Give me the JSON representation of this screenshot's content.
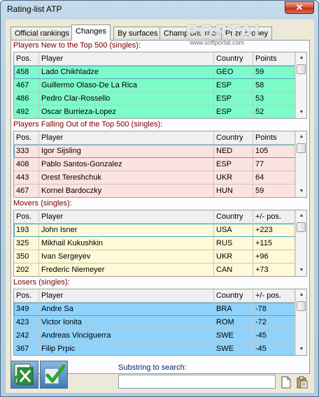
{
  "window": {
    "title": "Rating-list ATP",
    "close_glyph": "✕"
  },
  "tabs": [
    {
      "label": "Official rankings",
      "active": false
    },
    {
      "label": "Changes",
      "active": true
    },
    {
      "label": "By surfaces",
      "active": false
    },
    {
      "label": "Champions race",
      "active": false
    },
    {
      "label": "Prize money",
      "active": false
    }
  ],
  "watermark": {
    "brand": "PORTAL",
    "url": "www.softportal.com"
  },
  "colors": {
    "new_rows": "#7dfbc8",
    "out_rows": "#fde3e0",
    "movers_rows": "#fef9d6",
    "losers_rows": "#8fd3fb",
    "section_label": "#7a0000"
  },
  "sections": [
    {
      "title": "Players New to the Top 500 (singles):",
      "columns": [
        "Pos.",
        "Player",
        "Country",
        "Points"
      ],
      "rows": [
        [
          "458",
          "Lado Chikhladze",
          "GEO",
          "59"
        ],
        [
          "467",
          "Guillermo Olaso-De La Rica",
          "ESP",
          "58"
        ],
        [
          "486",
          "Pedro Clar-Rossello",
          "ESP",
          "53"
        ],
        [
          "492",
          "Oscar Burrieza-Lopez",
          "ESP",
          "52"
        ]
      ]
    },
    {
      "title": "Players Falling Out of the Top 500 (singles):",
      "columns": [
        "Pos.",
        "Player",
        "Country",
        "Points"
      ],
      "rows": [
        [
          "333",
          "Igor Sijsling",
          "NED",
          "105"
        ],
        [
          "408",
          "Pablo Santos-Gonzalez",
          "ESP",
          "77"
        ],
        [
          "443",
          "Orest Tereshchuk",
          "UKR",
          "64"
        ],
        [
          "467",
          "Kornel Bardoczky",
          "HUN",
          "59"
        ]
      ]
    },
    {
      "title": "Movers (singles):",
      "columns": [
        "Pos.",
        "Player",
        "Country",
        "+/- pos."
      ],
      "rows": [
        [
          "193",
          "John Isner",
          "USA",
          "+223"
        ],
        [
          "325",
          "Mikhail Kukushkin",
          "RUS",
          "+115"
        ],
        [
          "350",
          "Ivan Sergeyev",
          "UKR",
          "+96"
        ],
        [
          "202",
          "Frederic Niemeyer",
          "CAN",
          "+73"
        ]
      ]
    },
    {
      "title": "Losers (singles):",
      "columns": [
        "Pos.",
        "Player",
        "Country",
        "+/- pos."
      ],
      "rows": [
        [
          "349",
          "Andre Sa",
          "BRA",
          "-78"
        ],
        [
          "423",
          "Victor Ionita",
          "ROM",
          "-72"
        ],
        [
          "242",
          "Andreas Vinciguerra",
          "SWE",
          "-45"
        ],
        [
          "367",
          "Filip Prpic",
          "SWE",
          "-45"
        ]
      ]
    }
  ],
  "search": {
    "label": "Substring to search:",
    "value": ""
  },
  "icons": {
    "excel_button": "excel-export-icon",
    "apply_button": "checkmark-icon",
    "new_icon": "blank-document-icon",
    "paste_icon": "clipboard-icon"
  }
}
